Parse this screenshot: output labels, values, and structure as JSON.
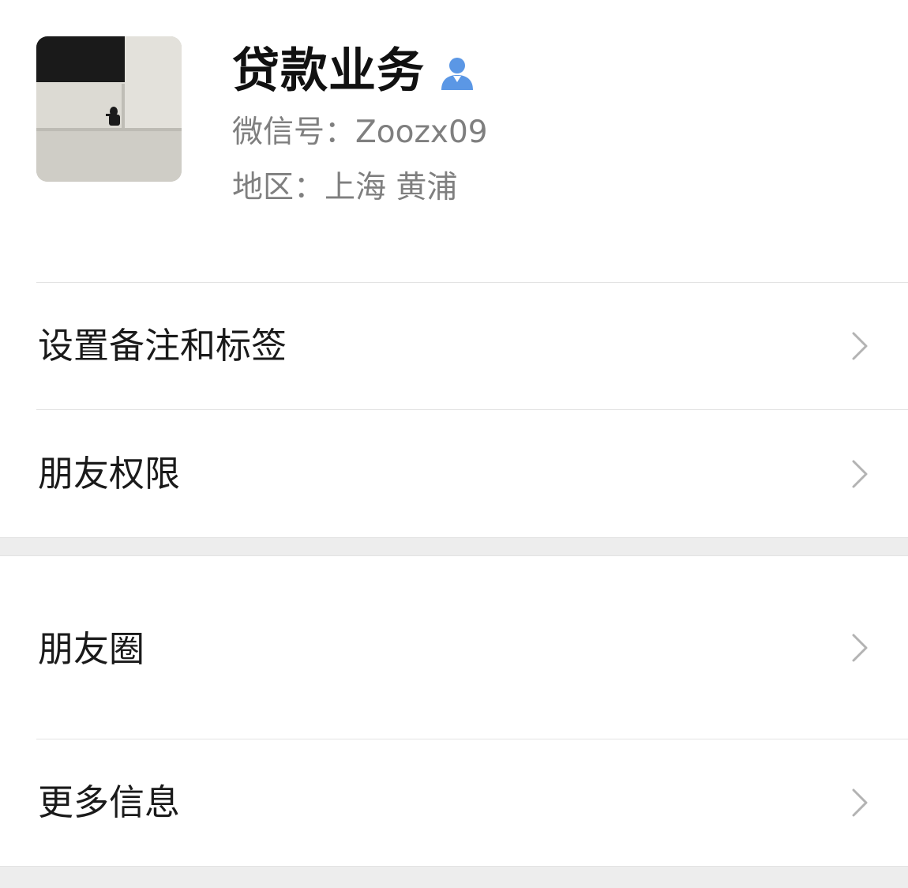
{
  "profile": {
    "name": "贷款业务",
    "wechat_id": "微信号：Zoozx09",
    "region": "地区：上海  黄浦",
    "avatar_icon": "avatar-photo",
    "contact_icon": "person-icon",
    "contact_icon_color": "#5b97e5"
  },
  "menu": {
    "remark_tags": "设置备注和标签",
    "friend_permissions": "朋友权限",
    "moments": "朋友圈",
    "more_info": "更多信息"
  },
  "icons": {
    "chevron": "chevron-right-icon"
  },
  "colors": {
    "background": "#ffffff",
    "section_gap": "#ededed",
    "divider": "#e3e3e3",
    "secondary_text": "#7f7f7f",
    "chevron": "#b3b3b3"
  }
}
